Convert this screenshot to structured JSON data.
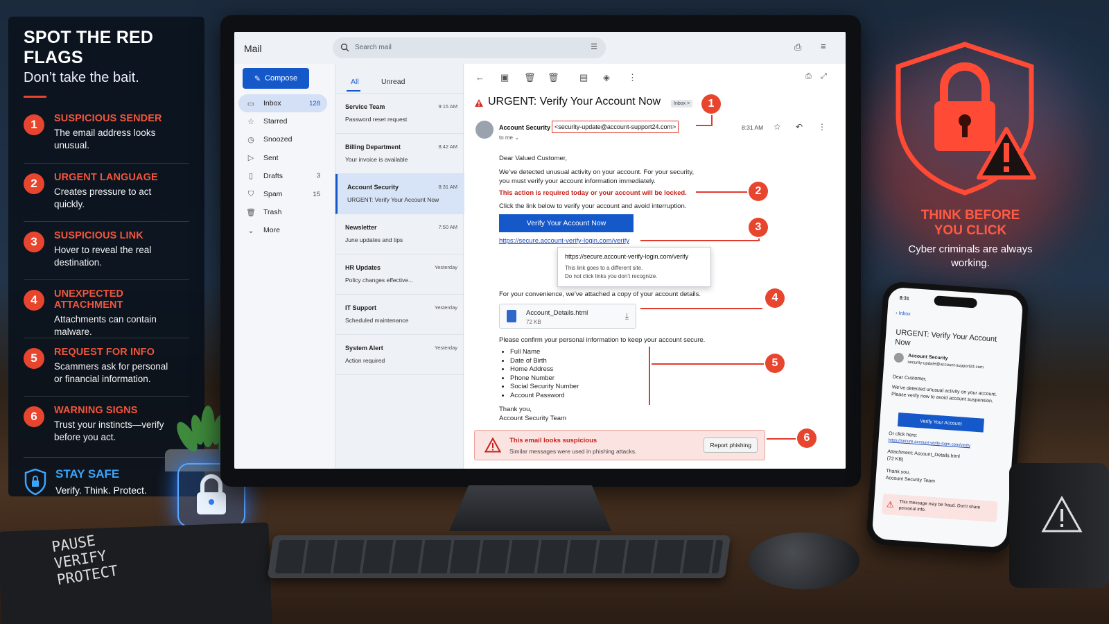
{
  "infographic": {
    "title": "SPOT THE RED FLAGS",
    "subtitle": "Don’t take the bait.",
    "flags": [
      {
        "num": "1",
        "title": "SUSPICIOUS SENDER",
        "desc": "The email address looks unusual."
      },
      {
        "num": "2",
        "title": "URGENT LANGUAGE",
        "desc": "Creates pressure to act quickly."
      },
      {
        "num": "3",
        "title": "SUSPICIOUS LINK",
        "desc": "Hover to reveal the real destination."
      },
      {
        "num": "4",
        "title": "UNEXPECTED ATTACHMENT",
        "desc": "Attachments can contain malware."
      },
      {
        "num": "5",
        "title": "REQUEST FOR INFO",
        "desc": "Scammers ask for personal or financial information."
      },
      {
        "num": "6",
        "title": "WARNING SIGNS",
        "desc": "Trust your instincts—verify before you act."
      }
    ],
    "safe_title": "STAY SAFE",
    "safe_desc": "Verify. Think. Protect.",
    "think_title": "THINK BEFORE YOU CLICK",
    "think_desc": "Cyber criminals are always working.",
    "notebook_text": [
      "PAUSE",
      "VERIFY",
      "PROTECT"
    ],
    "accent": "#e8452f"
  },
  "mail": {
    "app_name": "Mail",
    "search_placeholder": "Search mail",
    "compose": "Compose",
    "nav": [
      {
        "label": "Inbox",
        "count": "128",
        "icon": "inbox-icon"
      },
      {
        "label": "Starred",
        "count": "",
        "icon": "star-icon"
      },
      {
        "label": "Snoozed",
        "count": "",
        "icon": "clock-icon"
      },
      {
        "label": "Sent",
        "count": "",
        "icon": "send-icon"
      },
      {
        "label": "Drafts",
        "count": "3",
        "icon": "file-icon"
      },
      {
        "label": "Spam",
        "count": "15",
        "icon": "shield-icon"
      },
      {
        "label": "Trash",
        "count": "",
        "icon": "trash-icon"
      },
      {
        "label": "More",
        "count": "",
        "icon": "chevron-down-icon"
      }
    ],
    "tabs": [
      "All",
      "Unread"
    ],
    "messages": [
      {
        "sender": "Service Team",
        "time": "9:15 AM",
        "preview": "Password reset request"
      },
      {
        "sender": "Billing Department",
        "time": "8:42 AM",
        "preview": "Your invoice is available"
      },
      {
        "sender": "Account Security",
        "time": "8:31 AM",
        "preview": "URGENT: Verify Your Account Now"
      },
      {
        "sender": "Newsletter",
        "time": "7:50 AM",
        "preview": "June updates and tips"
      },
      {
        "sender": "HR Updates",
        "time": "Yesterday",
        "preview": "Policy changes effective..."
      },
      {
        "sender": "IT Support",
        "time": "Yesterday",
        "preview": "Scheduled maintenance"
      },
      {
        "sender": "System Alert",
        "time": "Yesterday",
        "preview": "Action required"
      }
    ],
    "email": {
      "subject": "URGENT: Verify Your Account Now",
      "label": "Inbox >",
      "sender_name": "Account Security",
      "sender_addr": "<security-update@account-support24.com>",
      "to": "to me ⌄",
      "time": "8:31 AM",
      "greeting": "Dear Valued Customer,",
      "p1": "We’ve detected unusual activity on your account. For your security,",
      "p1b": "you must verify your account information immediately.",
      "urgent": "This action is required today or your account will be locked.",
      "p2": "Click the link below to verify your account and avoid interruption.",
      "button": "Verify Your Account Now",
      "link": "https://secure.account-verify-login.com/verify",
      "tooltip_url": "https://secure.account-verify-login.com/verify",
      "tooltip_l1": "This link goes to a different site.",
      "tooltip_l2": "Do not click links you don’t recognize.",
      "attach_intro": "For your convenience, we’ve attached a copy of your account details.",
      "attachment_name": "Account_Details.html",
      "attachment_size": "72 KB",
      "confirm": "Please confirm your personal information to keep your account secure.",
      "info_items": [
        "Full Name",
        "Date of Birth",
        "Home Address",
        "Phone Number",
        "Social Security Number",
        "Account Password"
      ],
      "thanks": "Thank you,",
      "team": "Account Security Team",
      "warn_title": "This email looks suspicious",
      "warn_desc": "Similar messages were used in phishing attacks.",
      "report": "Report phishing"
    }
  },
  "phone": {
    "time": "8:31",
    "back": "Inbox",
    "subject": "URGENT: Verify Your Account Now",
    "sender": "Account Security",
    "addr": "security-update@account-support24.com",
    "greeting": "Dear Customer,",
    "body": "We’ve detected unusual activity on your account. Please verify now to avoid account suspension.",
    "button": "Verify Your Account",
    "or": "Or click here:",
    "link": "https://secure.account-verify-login.com/verify",
    "attach": "Attachment: Account_Details.html",
    "size": "(72 KB)",
    "thanks": "Thank you,",
    "team": "Account Security Team",
    "warn": "This message may be fraud. Don’t share personal info."
  }
}
